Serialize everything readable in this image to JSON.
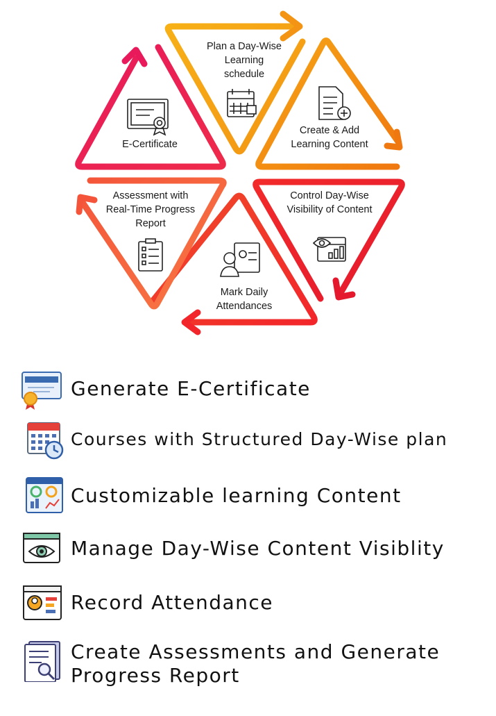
{
  "cycle": {
    "steps": [
      {
        "label": "Plan a Day-Wise Learning schedule",
        "icon": "calendar-schedule-icon",
        "color": "#f5a00e"
      },
      {
        "label": "Create & Add Learning Content",
        "icon": "document-add-icon",
        "color": "#f28a12"
      },
      {
        "label": "Control Day-Wise Visibility of Content",
        "icon": "eye-dashboard-icon",
        "color": "#ee1f2d"
      },
      {
        "label": "Mark Daily Attendances",
        "icon": "person-clipboard-icon",
        "color": "#f12e2e"
      },
      {
        "label": "Assessment with Real-Time Progress Report",
        "icon": "checklist-icon",
        "color": "#f66a3e"
      },
      {
        "label": "E-Certificate",
        "icon": "certificate-icon",
        "color": "#e8185a"
      }
    ]
  },
  "features": [
    {
      "label": "Generate E-Certificate",
      "icon": "certificate-badge-icon"
    },
    {
      "label": "Courses with Structured Day-Wise plan",
      "icon": "calendar-clock-icon"
    },
    {
      "label": "Customizable learning Content",
      "icon": "dashboard-icon"
    },
    {
      "label": "Manage Day-Wise Content Visiblity",
      "icon": "eye-window-icon"
    },
    {
      "label": "Record Attendance",
      "icon": "attendance-card-icon"
    },
    {
      "label": "Create Assessments and Generate Progress Report",
      "icon": "report-search-icon"
    }
  ],
  "colors": {
    "orange": "#f5a00e",
    "red": "#ee1f2d",
    "pink": "#e8185a",
    "coral": "#f66a3e"
  }
}
